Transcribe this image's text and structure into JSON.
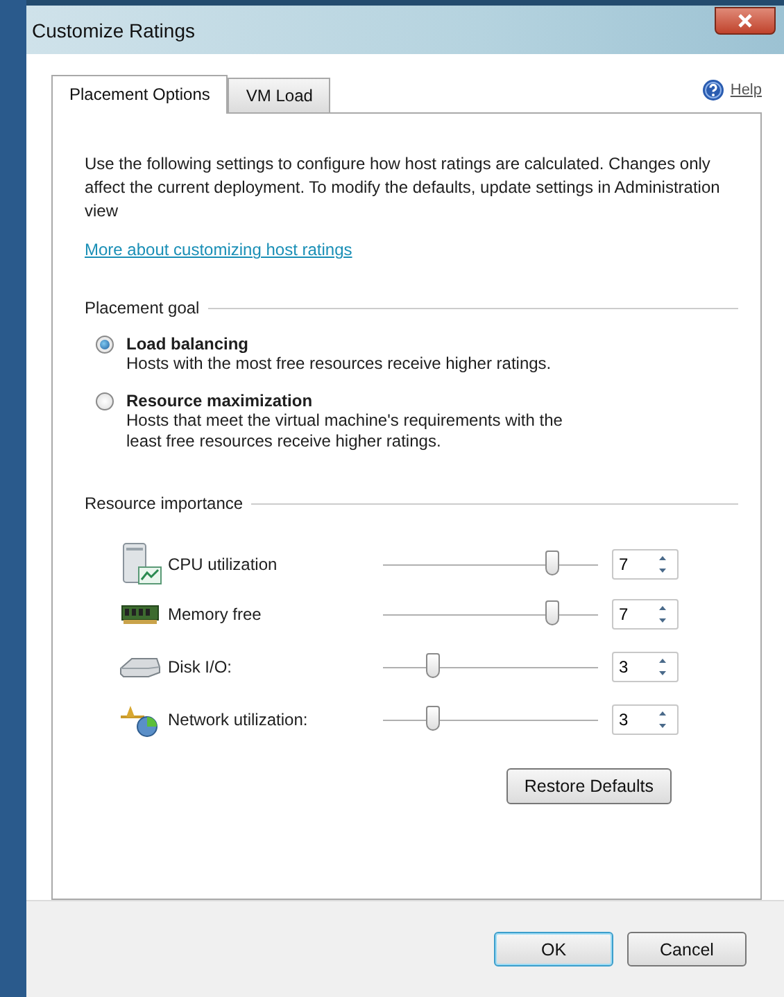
{
  "window": {
    "title": "Customize Ratings"
  },
  "tabs": [
    {
      "label": "Placement Options",
      "selected": true
    },
    {
      "label": "VM Load",
      "selected": false
    }
  ],
  "help": {
    "label": "Help"
  },
  "intro": "Use the following settings to configure how host ratings are calculated. Changes only affect the current deployment. To modify the defaults, update settings in Administration view",
  "link": "More about customizing host ratings",
  "placement_goal": {
    "title": "Placement goal",
    "options": [
      {
        "label": "Load balancing",
        "description": "Hosts with the most free resources receive higher ratings.",
        "selected": true
      },
      {
        "label": "Resource maximization",
        "description": "Hosts that meet the virtual machine's requirements with the least free resources receive higher ratings.",
        "selected": false
      }
    ]
  },
  "resource_importance": {
    "title": "Resource importance",
    "resources": [
      {
        "kind": "cpu",
        "name": "CPU utilization",
        "level": 0.79,
        "value": "7"
      },
      {
        "kind": "memory",
        "name": "Memory free",
        "level": 0.79,
        "value": "7"
      },
      {
        "kind": "disk",
        "name": "Disk I/O:",
        "level": 0.23,
        "value": "3"
      },
      {
        "kind": "network",
        "name": "Network utilization:",
        "level": 0.23,
        "value": "3"
      }
    ],
    "restore_button": "Restore Defaults"
  },
  "buttons": [
    {
      "label": "OK",
      "kind": "default"
    },
    {
      "label": "Cancel",
      "kind": "normal"
    }
  ]
}
